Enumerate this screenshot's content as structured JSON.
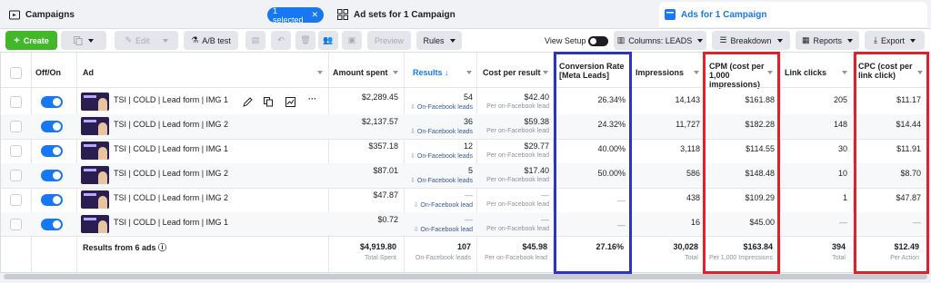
{
  "tabs": {
    "campaigns": "Campaigns",
    "selected_pill": "1 selected",
    "adsets": "Ad sets for 1 Campaign",
    "ads": "Ads for 1 Campaign"
  },
  "toolbar": {
    "create": "Create",
    "edit": "Edit",
    "ab_test": "A/B test",
    "preview": "Preview",
    "rules": "Rules",
    "view_setup": "View Setup",
    "columns": "Columns: LEADS",
    "breakdown": "Breakdown",
    "reports": "Reports",
    "export": "Export"
  },
  "columns": {
    "offon": "Off/On",
    "ad": "Ad",
    "amount_spent": "Amount spent",
    "results": "Results",
    "cpr": "Cost per result",
    "conv_l1": "Conversion Rate",
    "conv_l2": "[Meta Leads]",
    "impressions": "Impressions",
    "cpm_l1": "CPM (cost per",
    "cpm_l2": "1,000",
    "cpm_l3": "impressions)",
    "link_clicks": "Link clicks",
    "cpc_l1": "CPC (cost per",
    "cpc_l2": "link click)"
  },
  "rows": [
    {
      "name": "TSI | COLD | Lead form | IMG 1",
      "spent": "$2,289.45",
      "results": "54",
      "results_sub": "On-Facebook leads",
      "cpr": "$42.40",
      "cpr_sub": "Per on-Facebook lead",
      "conv": "26.34%",
      "impr": "14,143",
      "cpm": "$161.88",
      "clicks": "205",
      "cpc": "$11.17"
    },
    {
      "name": "TSI | COLD | Lead form | IMG 2",
      "spent": "$2,137.57",
      "results": "36",
      "results_sub": "On-Facebook leads",
      "cpr": "$59.38",
      "cpr_sub": "Per on-Facebook lead",
      "conv": "24.32%",
      "impr": "11,727",
      "cpm": "$182.28",
      "clicks": "148",
      "cpc": "$14.44"
    },
    {
      "name": "TSI | COLD | Lead form | IMG 1",
      "spent": "$357.18",
      "results": "12",
      "results_sub": "On-Facebook leads",
      "cpr": "$29.77",
      "cpr_sub": "Per on-Facebook lead",
      "conv": "40.00%",
      "impr": "3,118",
      "cpm": "$114.55",
      "clicks": "30",
      "cpc": "$11.91"
    },
    {
      "name": "TSI | COLD | Lead form | IMG 2",
      "spent": "$87.01",
      "results": "5",
      "results_sub": "On-Facebook leads",
      "cpr": "$17.40",
      "cpr_sub": "Per on-Facebook lead",
      "conv": "50.00%",
      "impr": "586",
      "cpm": "$148.48",
      "clicks": "10",
      "cpc": "$8.70"
    },
    {
      "name": "TSI | COLD | Lead form | IMG 2",
      "spent": "$47.87",
      "results": "—",
      "results_sub": "On-Facebook lead",
      "cpr": "—",
      "cpr_sub": "Per on-Facebook lead",
      "conv": "—",
      "impr": "438",
      "cpm": "$109.29",
      "clicks": "1",
      "cpc": "$47.87"
    },
    {
      "name": "TSI | COLD | Lead form | IMG 1",
      "spent": "$0.72",
      "results": "—",
      "results_sub": "On-Facebook lead",
      "cpr": "—",
      "cpr_sub": "Per on-Facebook lead",
      "conv": "—",
      "impr": "16",
      "cpm": "$45.00",
      "clicks": "—",
      "cpc": "—"
    }
  ],
  "footer": {
    "label": "Results from 6 ads",
    "spent": "$4,919.80",
    "spent_sub": "Total Spent",
    "results": "107",
    "results_sub": "On-Facebook leads",
    "cpr": "$45.98",
    "cpr_sub": "Per on-Facebook lead",
    "conv": "27.16%",
    "impr": "30,028",
    "impr_sub": "Total",
    "cpm": "$163.84",
    "cpm_sub": "Per 1,000 Impressions",
    "clicks": "394",
    "clicks_sub": "Total",
    "cpc": "$12.49",
    "cpc_sub": "Per Action"
  },
  "colors": {
    "accent": "#1877f2",
    "create_green": "#42b72a",
    "highlight_blue": "#2b35c2",
    "highlight_red": "#e0202a"
  }
}
